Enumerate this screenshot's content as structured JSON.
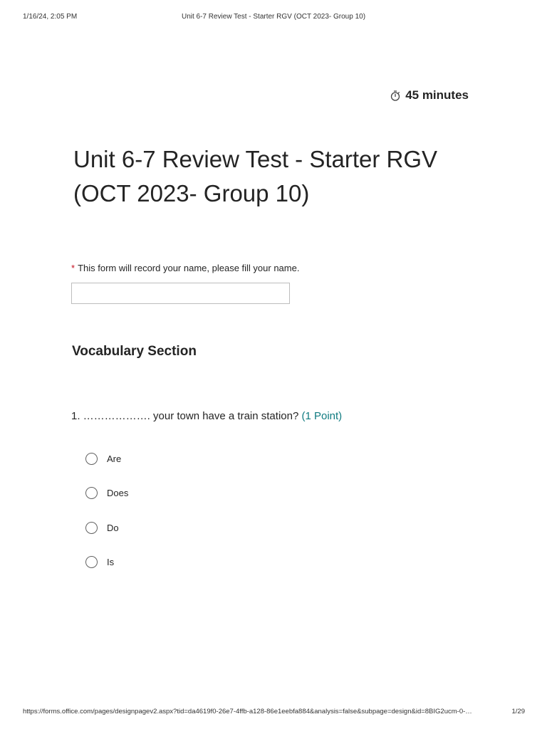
{
  "print_header": {
    "datetime": "1/16/24, 2:05 PM",
    "title": "Unit 6-7 Review Test - Starter RGV (OCT 2023- Group 10)"
  },
  "timer": {
    "icon": "stopwatch-icon",
    "label": "45 minutes"
  },
  "form": {
    "title_line1": "Unit 6-7 Review Test - Starter RGV",
    "title_line2": "(OCT 2023- Group 10)"
  },
  "name_question": {
    "required_mark": "*",
    "text": "This form will record your name, please fill your name.",
    "value": "",
    "placeholder": ""
  },
  "section": {
    "title": "Vocabulary Section"
  },
  "question1": {
    "text": "1. ………………. your town have a train station?",
    "points": "(1 Point)",
    "options": [
      {
        "label": "Are"
      },
      {
        "label": "Does"
      },
      {
        "label": "Do"
      },
      {
        "label": "Is"
      }
    ]
  },
  "print_footer": {
    "url": "https://forms.office.com/pages/designpagev2.aspx?tid=da4619f0-26e7-4ffb-a128-86e1eebfa884&analysis=false&subpage=design&id=8BIG2ucm-0-…",
    "page": "1/29"
  },
  "colors": {
    "points_accent": "#0f7b80",
    "required": "#c50f1f",
    "text": "#242424"
  }
}
